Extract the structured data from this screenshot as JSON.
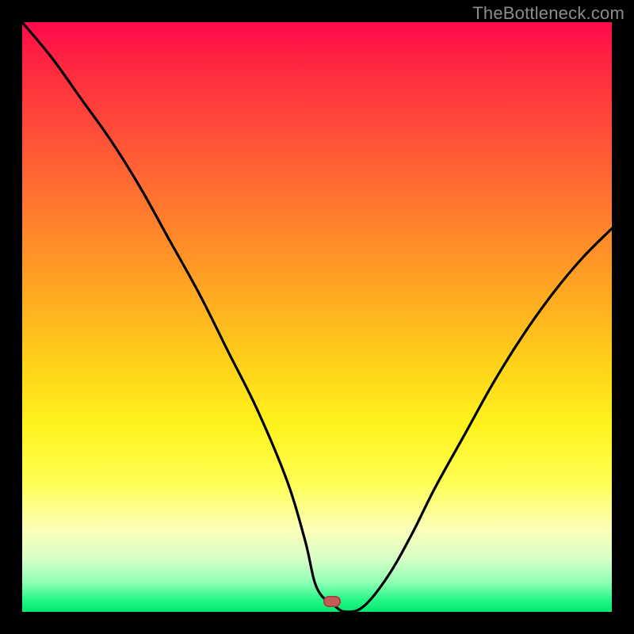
{
  "watermark": "TheBottleneck.com",
  "colors": {
    "background": "#000000",
    "curve_stroke": "#000000",
    "marker_fill": "#c55a56",
    "marker_outline": "#9a3f3a"
  },
  "marker": {
    "x_frac": 0.525,
    "y_frac": 0.982,
    "label": "selected-point"
  },
  "chart_data": {
    "type": "line",
    "title": "",
    "xlabel": "",
    "ylabel": "",
    "xlim": [
      0,
      100
    ],
    "ylim": [
      0,
      100
    ],
    "grid": false,
    "legend": false,
    "series": [
      {
        "name": "curve",
        "x": [
          0,
          5,
          10,
          15,
          20,
          25,
          30,
          35,
          40,
          45,
          48,
          50,
          53,
          55,
          58,
          62,
          66,
          70,
          75,
          80,
          85,
          90,
          95,
          100
        ],
        "values": [
          100,
          94,
          87,
          80,
          72,
          63,
          54,
          44,
          34,
          22,
          12,
          4,
          1,
          0,
          1,
          6,
          13,
          21,
          30,
          39,
          47,
          54,
          60,
          65
        ]
      }
    ],
    "background_gradient": {
      "direction": "vertical",
      "stops": [
        {
          "pos": 0.0,
          "color": "#ff0a4a"
        },
        {
          "pos": 0.45,
          "color": "#ffa522"
        },
        {
          "pos": 0.78,
          "color": "#ffff53"
        },
        {
          "pos": 0.95,
          "color": "#8fffb5"
        },
        {
          "pos": 1.0,
          "color": "#06e86f"
        }
      ]
    },
    "marker_point": {
      "x": 52.5,
      "y": 0
    }
  }
}
